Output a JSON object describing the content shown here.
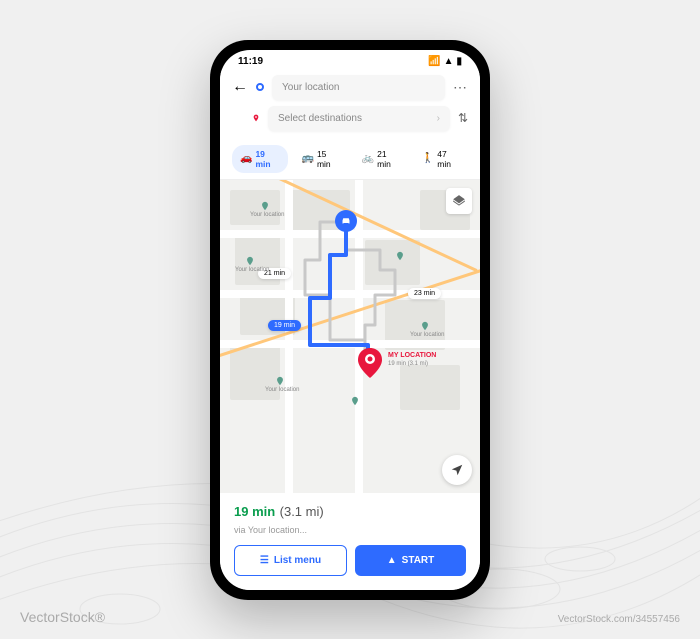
{
  "status": {
    "time": "11:19"
  },
  "inputs": {
    "origin_placeholder": "Your location",
    "dest_placeholder": "Select destinations"
  },
  "modes": {
    "car": "19 min",
    "transit": "15 min",
    "bike": "21 min",
    "walk": "47 min"
  },
  "map": {
    "my_location_label": "MY LOCATION",
    "my_location_sub": "19 min (3.1 mi)",
    "badge_main": "19 min",
    "badge_alt1": "21 min",
    "badge_alt2": "23 min",
    "pin_label": "Your location"
  },
  "footer": {
    "time": "19 min",
    "distance": " (3.1 mi)",
    "via": "via Your location...",
    "list_btn": "List menu",
    "start_btn": "START"
  },
  "watermark": "VectorStock®",
  "image_id": "VectorStock.com/34557456"
}
